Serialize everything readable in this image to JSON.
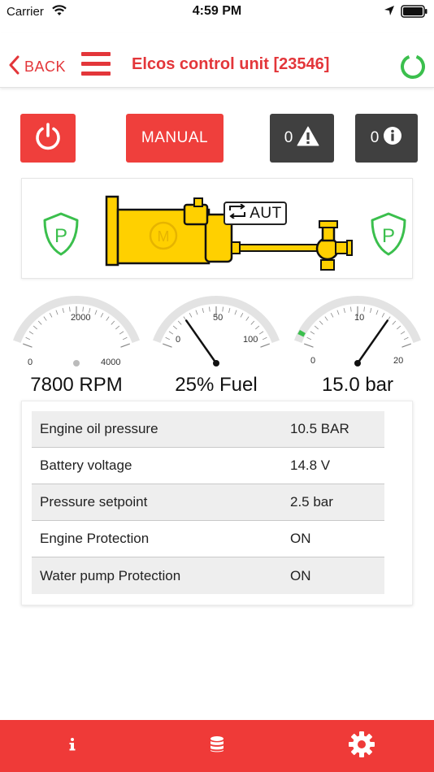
{
  "status_bar": {
    "carrier": "Carrier",
    "time": "4:59 PM"
  },
  "nav": {
    "back_label": "BACK",
    "title": "Elcos control unit [23546]"
  },
  "actions": {
    "manual_label": "MANUAL",
    "alarm_count": "0",
    "info_count": "0"
  },
  "unit_status": {
    "left_shield_letter": "P",
    "right_shield_letter": "P",
    "engine_emblem_letter": "M",
    "mode_label": "AUT"
  },
  "gauges": [
    {
      "reading": "7800 RPM",
      "min_label": "0",
      "mid_label": "2000",
      "max_label": "4000",
      "min": 0,
      "max": 4000,
      "value": 7800
    },
    {
      "reading": "25% Fuel",
      "min_label": "0",
      "mid_label": "50",
      "max_label": "100",
      "min": 0,
      "max": 100,
      "value": 25
    },
    {
      "reading": "15.0 bar",
      "min_label": "0",
      "mid_label": "10",
      "max_label": "20",
      "min": 0,
      "max": 20,
      "value": 15.0
    }
  ],
  "params": [
    {
      "name": "Engine oil pressure",
      "value": "10.5 BAR"
    },
    {
      "name": "Battery voltage",
      "value": "14.8 V"
    },
    {
      "name": "Pressure setpoint",
      "value": "2.5 bar"
    },
    {
      "name": "Engine Protection",
      "value": "ON"
    },
    {
      "name": "Water pump Protection",
      "value": "ON"
    }
  ],
  "icons": {
    "back": "chevron-left-icon",
    "menu": "hamburger-menu-icon",
    "refresh": "refresh-ring-icon",
    "power": "power-icon",
    "alarm": "warning-icon",
    "info": "info-icon",
    "tab_info": "info-icon",
    "tab_data": "database-icon",
    "tab_settings": "gear-icon"
  },
  "colors": {
    "accent": "#ef3f3c",
    "dark_button": "#404040",
    "status_green": "#3bbf4d",
    "engine_yellow": "#ffd000"
  }
}
